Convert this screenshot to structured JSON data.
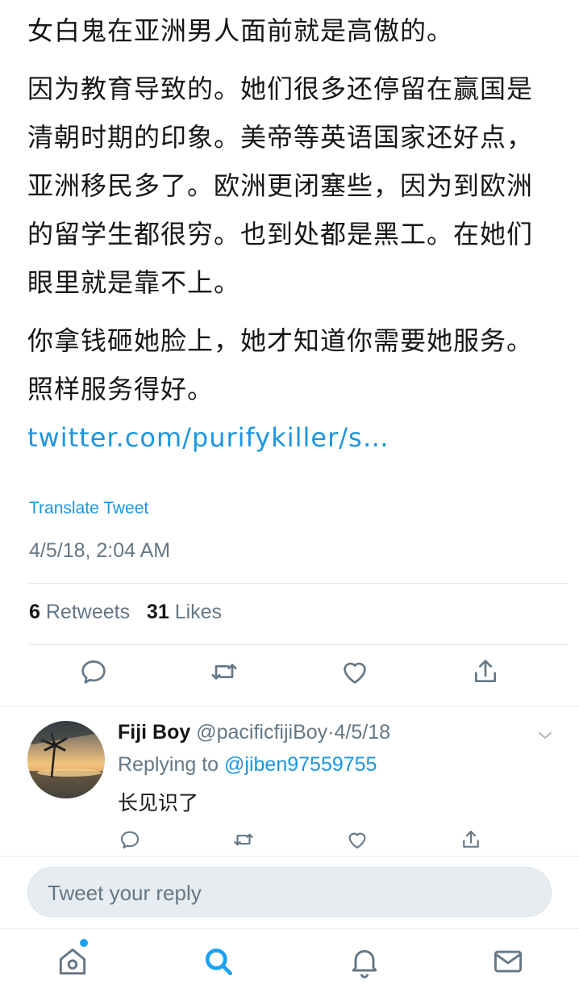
{
  "tweet": {
    "paragraphs": [
      "女白鬼在亚洲男人面前就是高傲的。",
      "因为教育导致的。她们很多还停留在赢国是清朝时期的印象。美帝等英语国家还好点，亚洲移民多了。欧洲更闭塞些，因为到欧洲的留学生都很穷。也到处都是黑工。在她们眼里就是靠不上。"
    ],
    "last_paragraph_text": "你拿钱砸她脸上，她才知道你需要她服务。照样服务得好。",
    "link_text": "twitter.com/purifykiller/s…",
    "translate_label": "Translate Tweet",
    "timestamp": "4/5/18, 2:04 AM",
    "retweets_count": "6",
    "retweets_label": "Retweets",
    "likes_count": "31",
    "likes_label": "Likes"
  },
  "actions": {
    "icons": [
      "reply-icon",
      "retweet-icon",
      "like-icon",
      "share-icon"
    ]
  },
  "reply": {
    "display_name": "Fiji Boy",
    "handle": "@pacificfijiBoy",
    "separator": "·",
    "date": "4/5/18",
    "replying_prefix": "Replying to",
    "replying_handle": "@jiben97559755",
    "text": "长见识了"
  },
  "compose": {
    "placeholder": "Tweet your reply"
  },
  "tabbar": {
    "icons": [
      "home-icon",
      "search-icon",
      "notifications-icon",
      "messages-icon"
    ]
  },
  "colors": {
    "accent": "#1b95e0",
    "secondary_text": "#657786",
    "divider": "#e1e8ed",
    "compose_bg": "#e6ecf0"
  }
}
